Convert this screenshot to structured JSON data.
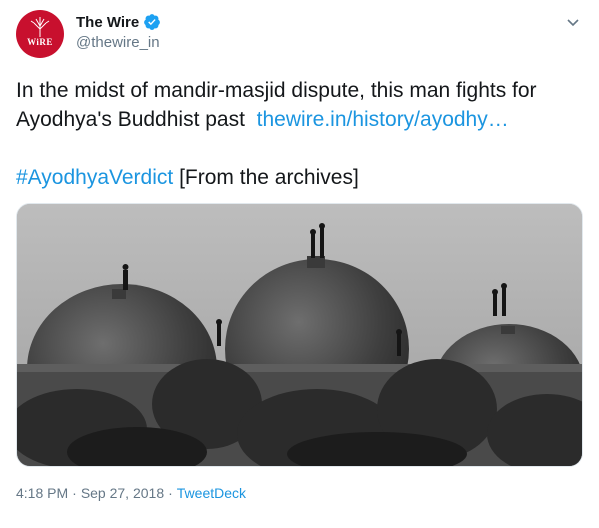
{
  "author": {
    "display_name": "The Wire",
    "handle": "@thewire_in",
    "avatar_wordmark": "WiRE",
    "verified": true
  },
  "tweet": {
    "line1": "In the midst of mandir-masjid dispute, this man fights for",
    "line2_text": "Ayodhya's Buddhist past",
    "link": "thewire.in/history/ayodhy…",
    "hashtag": "#AyodhyaVerdict",
    "hashtag_tail": " [From the archives]"
  },
  "media": {
    "icon": "photo-icon"
  },
  "meta": {
    "time": "4:18 PM",
    "separator1": "·",
    "date": "Sep 27, 2018",
    "separator2": "·",
    "source": "TweetDeck"
  },
  "colors": {
    "link": "#1b95e0",
    "verified": "#1da1f2",
    "avatar_bg": "#c8102e",
    "muted": "#657786"
  }
}
